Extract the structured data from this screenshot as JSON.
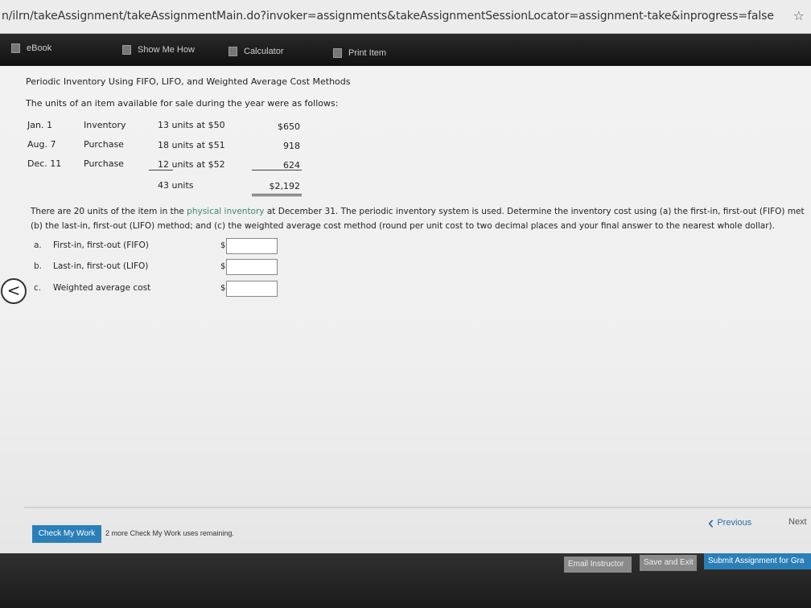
{
  "browser": {
    "url": "n/ilrn/takeAssignment/takeAssignmentMain.do?invoker=assignments&takeAssignmentSessionLocator=assignment-take&inprogress=false",
    "bookmark_icon": "star-icon"
  },
  "toolbar": {
    "ebook": "eBook",
    "show_me_how": "Show Me How",
    "calculator": "Calculator",
    "print_item": "Print Item"
  },
  "problem": {
    "title": "Periodic Inventory Using FIFO, LIFO, and Weighted Average Cost Methods",
    "intro": "The units of an item available for sale during the year were as follows:",
    "rows": [
      {
        "date": "Jan. 1",
        "type": "Inventory",
        "units": "13 units at $50",
        "cost": "$650"
      },
      {
        "date": "Aug. 7",
        "type": "Purchase",
        "units": "18 units at $51",
        "cost": "918"
      },
      {
        "date": "Dec. 11",
        "type": "Purchase",
        "units": "12 units at $52",
        "cost": "624"
      }
    ],
    "total_units": "43 units",
    "total_cost": "$2,192",
    "question_line1_a": "There are 20 units of the item in the ",
    "question_link": "physical inventory",
    "question_line1_b": " at December 31. The periodic inventory system is used. Determine the inventory cost using (a) the first-in, first-out (FIFO) met",
    "question_line2": "(b) the last-in, first-out (LIFO) method; and (c) the weighted average cost method (round per unit cost to two decimal places and your final answer to the nearest whole dollar).",
    "answers": [
      {
        "letter": "a.",
        "label": "First-in, first-out (FIFO)",
        "currency": "$",
        "value": ""
      },
      {
        "letter": "b.",
        "label": "Last-in, first-out (LIFO)",
        "currency": "$",
        "value": ""
      },
      {
        "letter": "c.",
        "label": "Weighted average cost",
        "currency": "$",
        "value": ""
      }
    ]
  },
  "nav": {
    "prev_arrow": "<",
    "check_my_work": "Check My Work",
    "remaining": "2 more Check My Work uses remaining.",
    "previous": "Previous",
    "next": "Next"
  },
  "footer": {
    "email_instructor": "Email Instructor",
    "save_and_exit": "Save and Exit",
    "submit": "Submit Assignment for Gra"
  }
}
